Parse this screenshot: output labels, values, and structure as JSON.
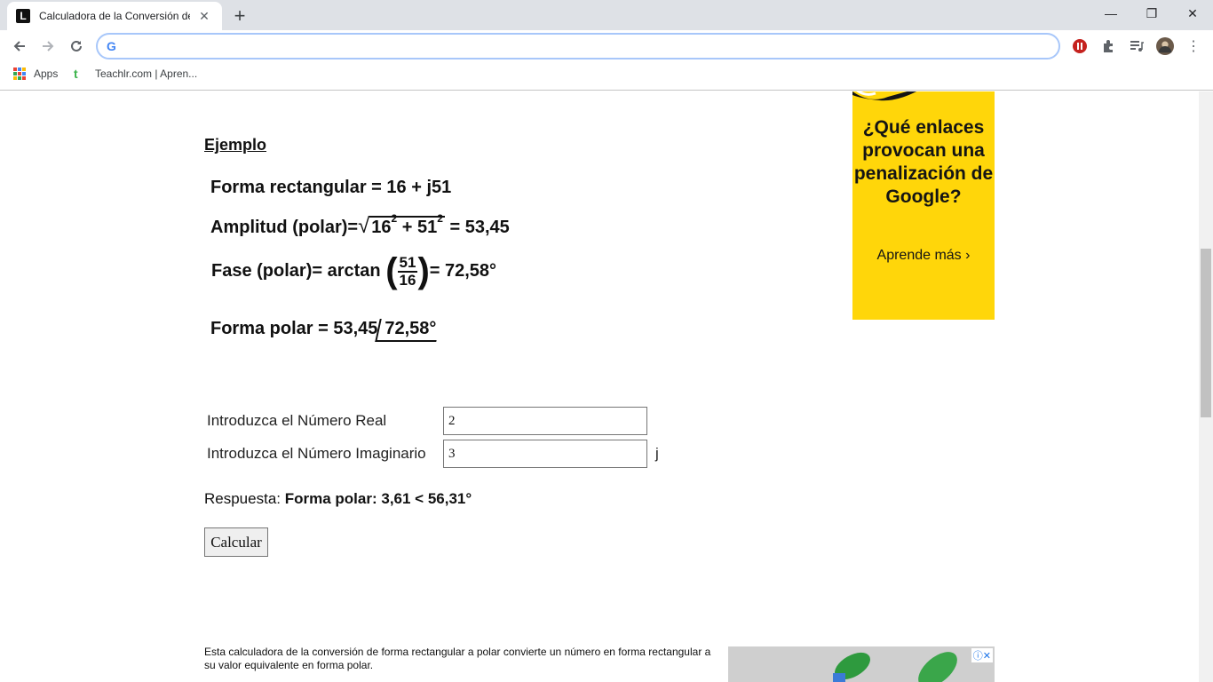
{
  "browser": {
    "tab_title": "Calculadora de la Conversión de",
    "tab_favicon_letter": "L",
    "tab_close": "✕",
    "new_tab": "+",
    "window_controls": {
      "minimize": "—",
      "restore": "❐",
      "close": "✕"
    },
    "address_value": "",
    "google_letter": "G",
    "bookmarks": [
      {
        "label": "Apps",
        "icon": "apps-grid-icon"
      },
      {
        "label": "Teachlr.com | Apren...",
        "icon": "teachlr-icon"
      }
    ],
    "teachlr_letter": "t"
  },
  "example": {
    "title": "Ejemplo",
    "rect_line": "Forma rectangular = 16 + j51",
    "amp_prefix": "Amplitud  (polar)=",
    "amp_a": "16",
    "amp_plus": " + 51",
    "amp_exp": "2",
    "amp_result": " = 53,45",
    "phase_prefix": "Fase  (polar)= arctan ",
    "phase_num": "51",
    "phase_den": "16",
    "phase_result": "= 72,58°",
    "polar_prefix": "Forma polar =  53,45",
    "polar_angle": "72,58°"
  },
  "form": {
    "real_label": "Introduzca el Número Real",
    "real_value": "2",
    "imag_label": "Introduzca el Número Imaginario",
    "imag_value": "3",
    "imag_unit": "j",
    "answer_label": "Respuesta: ",
    "answer_value": "Forma polar: 3,61 < 56,31°",
    "calc_button": "Calcular"
  },
  "description": "Esta calculadora de la conversión de forma rectangular a polar convierte un número en forma rectangular a su valor equivalente en forma polar.",
  "ad": {
    "headline": "¿Qué enlaces provocan una penalización de Google?",
    "cta": "Aprende más",
    "cta_arrow": "›",
    "color": "#ffd60a",
    "badge": "ⓘ✕"
  }
}
